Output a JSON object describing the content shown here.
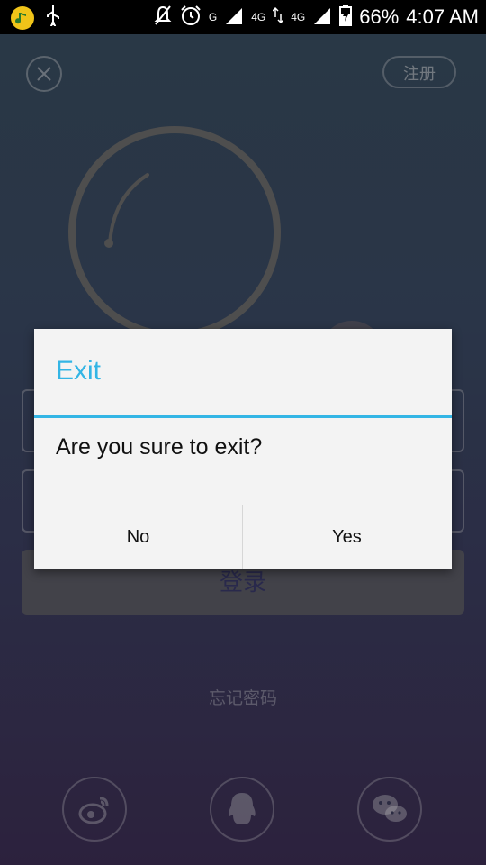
{
  "status_bar": {
    "network_g": "G",
    "network_4g_a": "4G",
    "network_4g_b": "4G",
    "battery": "66%",
    "time": "4:07 AM",
    "icons": [
      "app-icon",
      "usb-icon",
      "mute-icon",
      "alarm-icon",
      "signal-icon",
      "data-transfer-icon",
      "battery-icon"
    ]
  },
  "login_screen": {
    "register_label": "注册",
    "login_label": "登录",
    "forgot_password": "忘记密码",
    "social_icons": [
      "weibo-icon",
      "qq-icon",
      "wechat-icon"
    ]
  },
  "dialog": {
    "title": "Exit",
    "message": "Are you sure to exit?",
    "negative_label": "No",
    "positive_label": "Yes",
    "accent_color": "#33b5e5"
  }
}
